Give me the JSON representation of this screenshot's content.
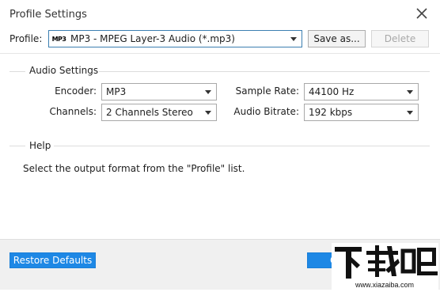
{
  "window": {
    "title": "Profile Settings"
  },
  "profile": {
    "label": "Profile:",
    "selected": "MP3 - MPEG Layer-3 Audio (*.mp3)",
    "icon_text": "MP3",
    "save_as_label": "Save as...",
    "delete_label": "Delete"
  },
  "audio_settings": {
    "heading": "Audio Settings",
    "encoder_label": "Encoder:",
    "encoder_value": "MP3",
    "channels_label": "Channels:",
    "channels_value": "2 Channels Stereo",
    "sample_rate_label": "Sample Rate:",
    "sample_rate_value": "44100 Hz",
    "audio_bitrate_label": "Audio Bitrate:",
    "audio_bitrate_value": "192 kbps"
  },
  "help": {
    "heading": "Help",
    "text": "Select the output format from the \"Profile\" list."
  },
  "footer": {
    "restore_defaults_label": "Restore Defaults",
    "ok_partial_label": "O"
  },
  "watermark": {
    "main": "下载吧",
    "url": "www.xiazaiba.com"
  },
  "colors": {
    "accent": "#1e88e5",
    "footer_bg": "#f0f0f0",
    "combo_focus_border": "#3c7fb1"
  }
}
